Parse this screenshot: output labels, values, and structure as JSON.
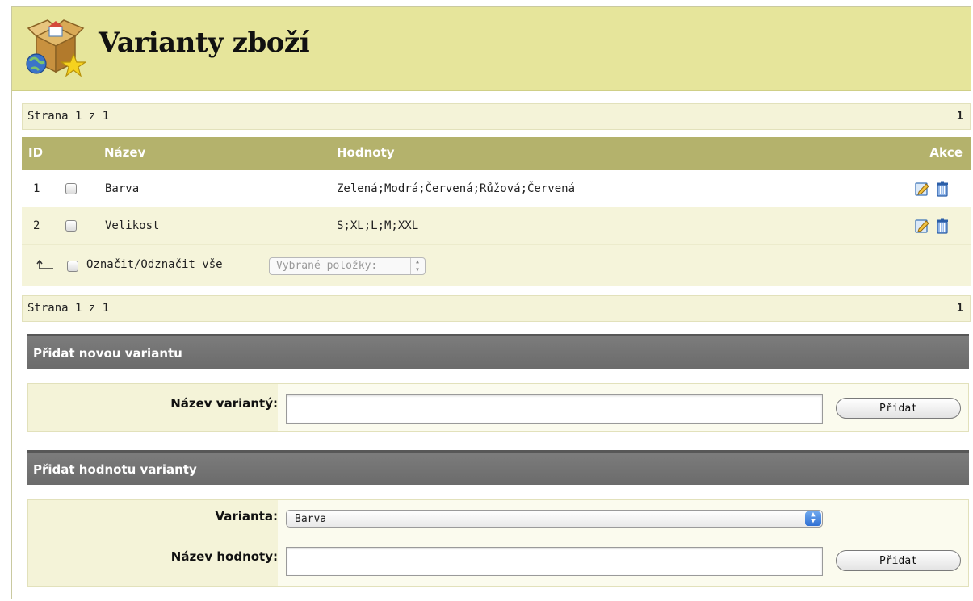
{
  "page": {
    "title": "Varianty zboží"
  },
  "pager_top": {
    "label": "Strana 1 z 1",
    "page": "1"
  },
  "pager_bottom": {
    "label": "Strana 1 z 1",
    "page": "1"
  },
  "table": {
    "columns": {
      "id": "ID",
      "name": "Název",
      "values": "Hodnoty",
      "actions": "Akce"
    },
    "rows": [
      {
        "id": "1",
        "name": "Barva",
        "values": "Zelená;Modrá;Červená;Růžová;Červená"
      },
      {
        "id": "2",
        "name": "Velikost",
        "values": "S;XL;L;M;XXL"
      }
    ],
    "select_all_label": "Označit/Odznačit vše",
    "bulk_select_placeholder": "Vybrané položky:"
  },
  "add_variant": {
    "heading": "Přidat novou variantu",
    "name_label": "Název variantý:",
    "name_value": "",
    "submit_label": "Přidat"
  },
  "add_value": {
    "heading": "Přidat hodnotu varianty",
    "variant_label": "Varianta:",
    "variant_selected": "Barva",
    "value_label": "Název hodnoty:",
    "value_value": "",
    "submit_label": "Přidat"
  },
  "colors": {
    "header_bg": "#e6e59b",
    "table_header_bg": "#b4b26c",
    "section_bar_bg": "#6f6f6f",
    "row_alt_bg": "#f5f4da"
  },
  "icons": [
    "logo-box-icon",
    "edit-icon",
    "trash-icon",
    "select-all-arrow-icon",
    "dropdown-arrows-icon"
  ]
}
